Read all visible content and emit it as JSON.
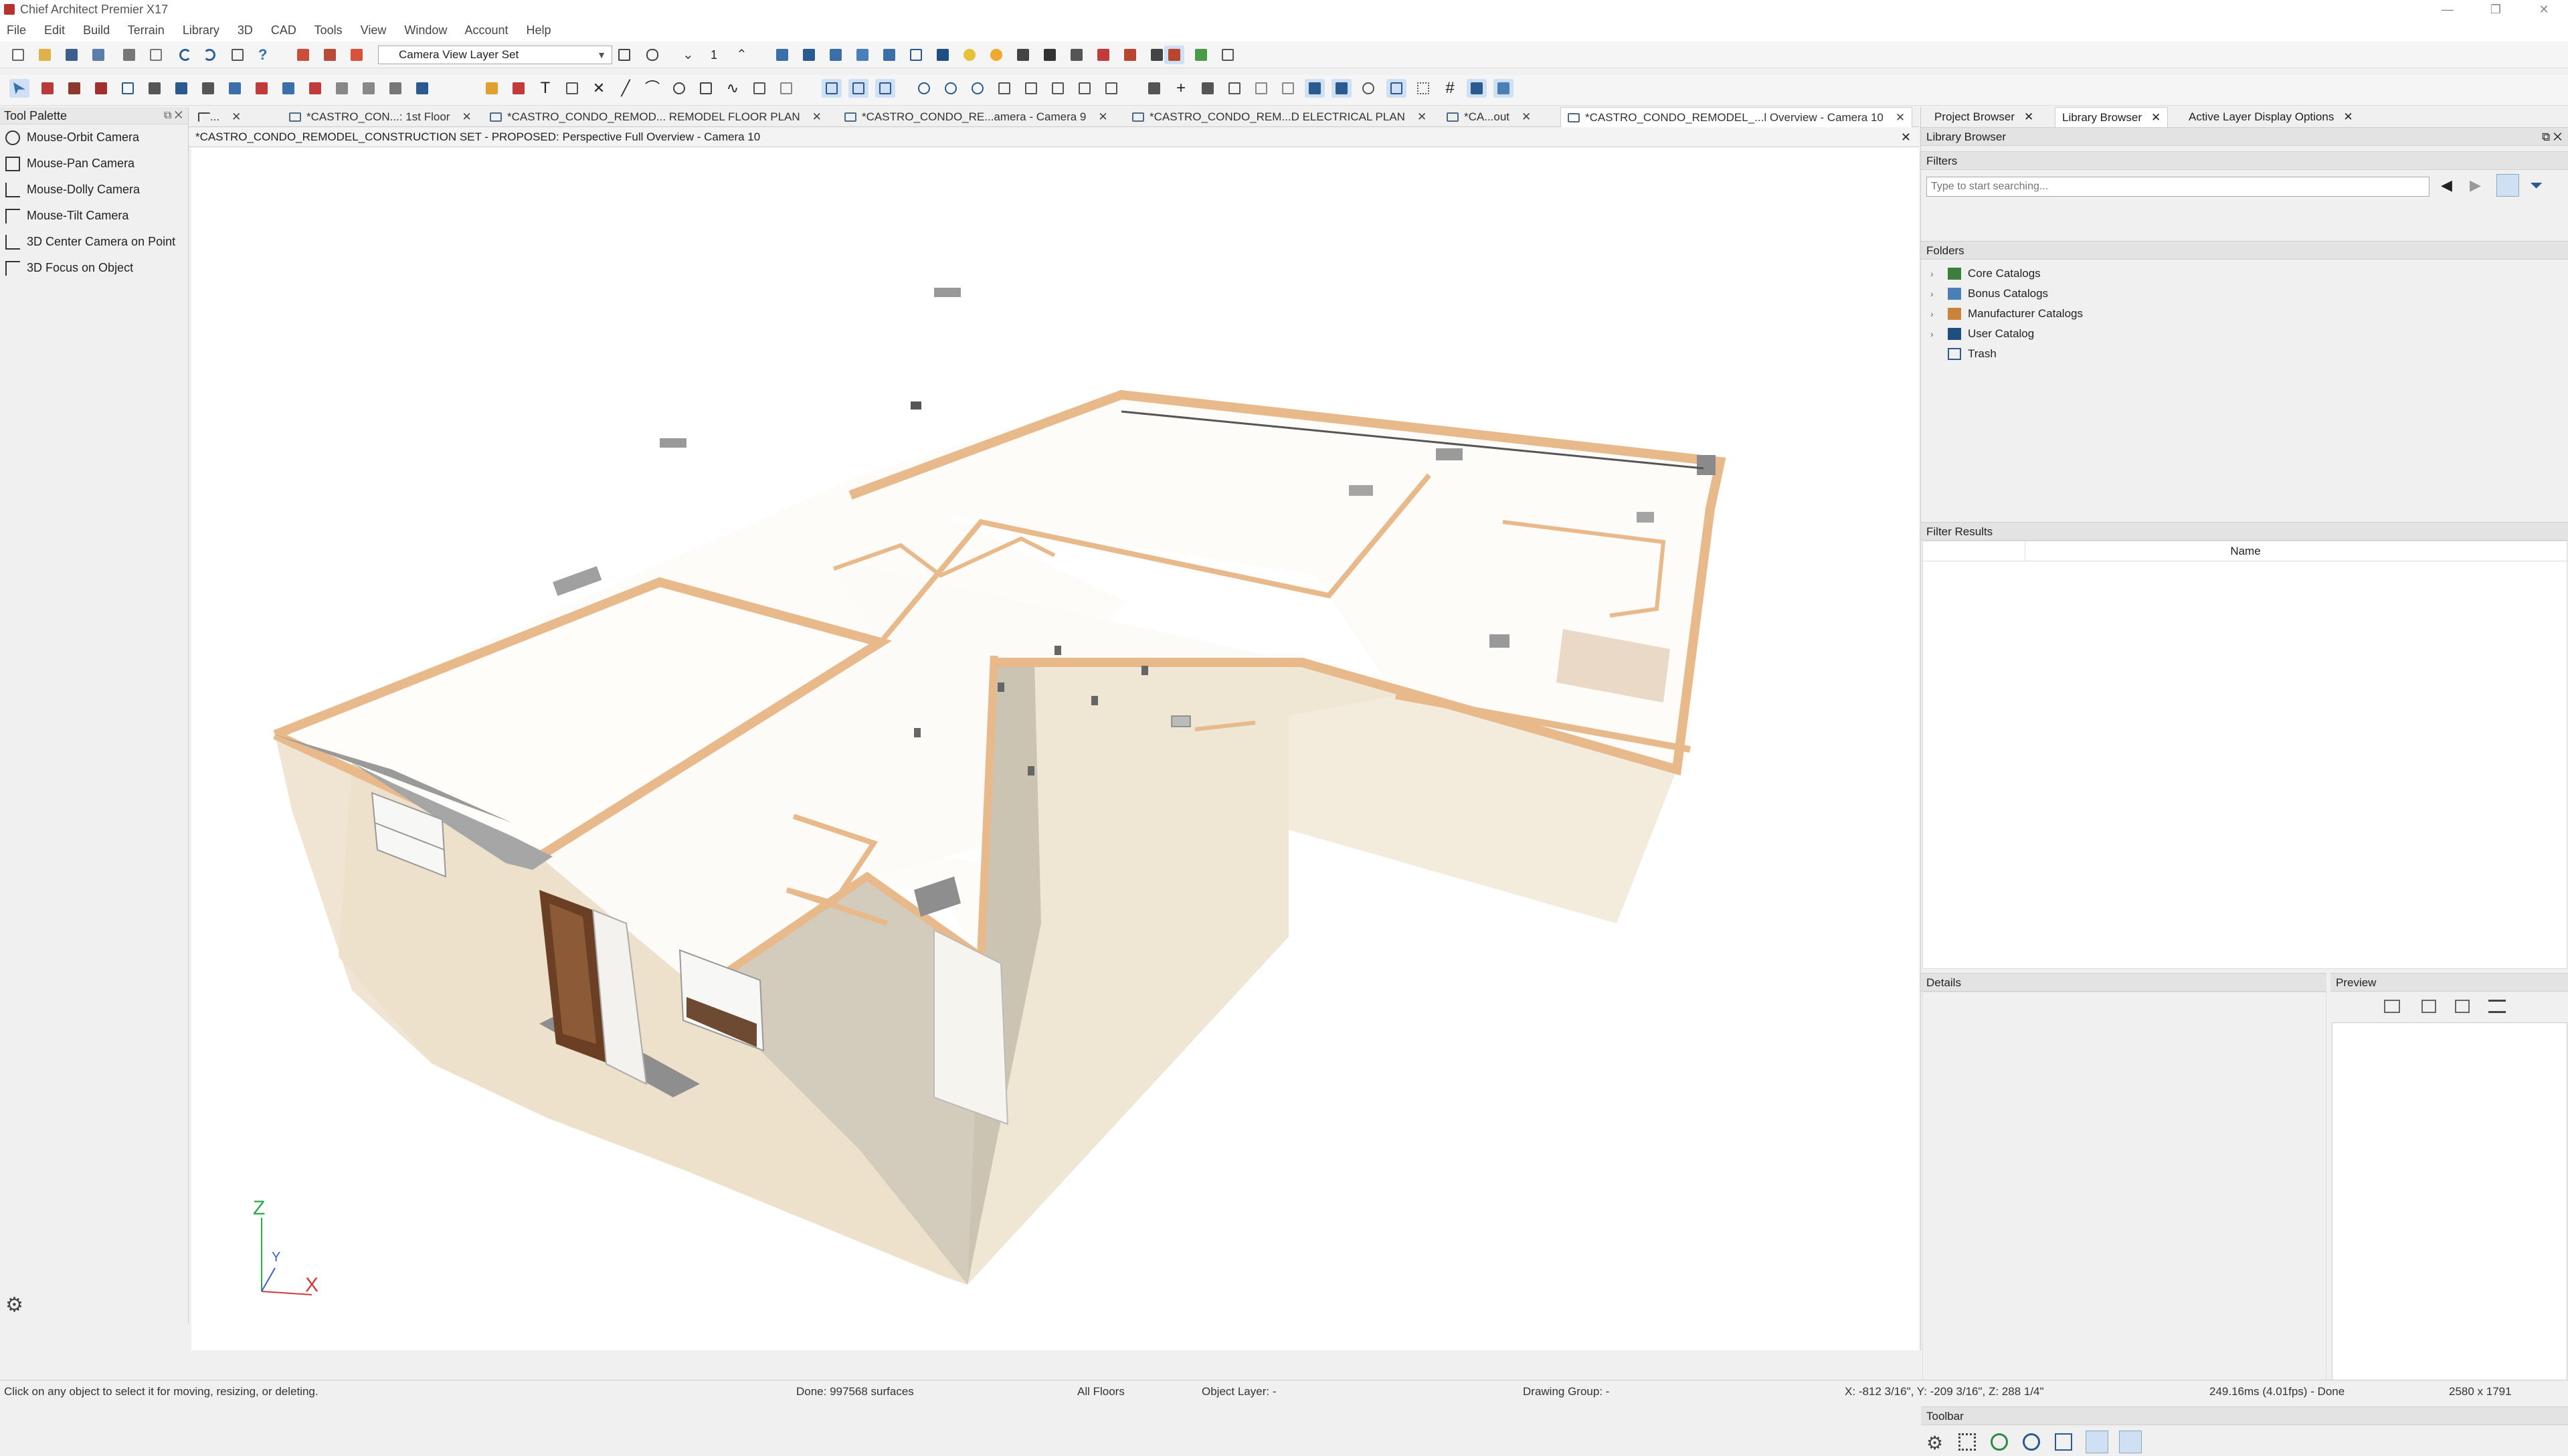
{
  "app": {
    "title": "Chief Architect Premier X17"
  },
  "menu": [
    "File",
    "Edit",
    "Build",
    "Terrain",
    "Library",
    "3D",
    "CAD",
    "Tools",
    "View",
    "Window",
    "Account",
    "Help"
  ],
  "toolbar": {
    "layer_set": "Camera View Layer Set",
    "floor_number": "1"
  },
  "tool_palette": {
    "title": "Tool Palette",
    "items": [
      "Mouse-Orbit Camera",
      "Mouse-Pan Camera",
      "Mouse-Dolly Camera",
      "Mouse-Tilt Camera",
      "3D Center Camera on Point",
      "3D Focus on Object"
    ]
  },
  "tabs": [
    {
      "label": "..."
    },
    {
      "label": "*CASTRO_CON...: 1st Floor"
    },
    {
      "label": "*CASTRO_CONDO_REMOD... REMODEL FLOOR PLAN"
    },
    {
      "label": "*CASTRO_CONDO_RE...amera - Camera 9"
    },
    {
      "label": "*CASTRO_CONDO_REM...D ELECTRICAL PLAN"
    },
    {
      "label": "*CA...out"
    },
    {
      "label": "*CASTRO_CONDO_REMODEL_...l Overview - Camera 10"
    }
  ],
  "view": {
    "title": "*CASTRO_CONDO_REMODEL_CONSTRUCTION SET - PROPOSED: Perspective Full Overview - Camera 10"
  },
  "axes": {
    "z": "Z",
    "y": "Y",
    "x": "X"
  },
  "right_tabs": [
    "Project Browser",
    "Library Browser",
    "Active Layer Display Options"
  ],
  "library": {
    "title": "Library Browser",
    "filters_label": "Filters",
    "search_placeholder": "Type to start searching...",
    "folders_label": "Folders",
    "folders": [
      "Core Catalogs",
      "Bonus Catalogs",
      "Manufacturer Catalogs",
      "User Catalog",
      "Trash"
    ],
    "filter_results_label": "Filter Results",
    "results_column": "Name",
    "details_label": "Details",
    "preview_label": "Preview",
    "toolbar_label": "Toolbar"
  },
  "status": {
    "hint": "Click on any object to select it for moving, resizing, or deleting.",
    "done": "Done:  997568 surfaces",
    "floors": "All Floors",
    "object_layer": "Object Layer: -",
    "drawing_group": "Drawing Group: -",
    "coords": "X: -812 3/16\", Y: -209 3/16\", Z: 288 1/4\"",
    "timing": "249.16ms (4.01fps) - Done",
    "resolution": "2580 x 1791"
  },
  "colors": {
    "wall_top": "#e8b98a",
    "wall_side": "#efe6d4",
    "wall_shade": "#cfc8b8",
    "floor": "#fdfcf8",
    "accent": "#2f6fb0"
  }
}
